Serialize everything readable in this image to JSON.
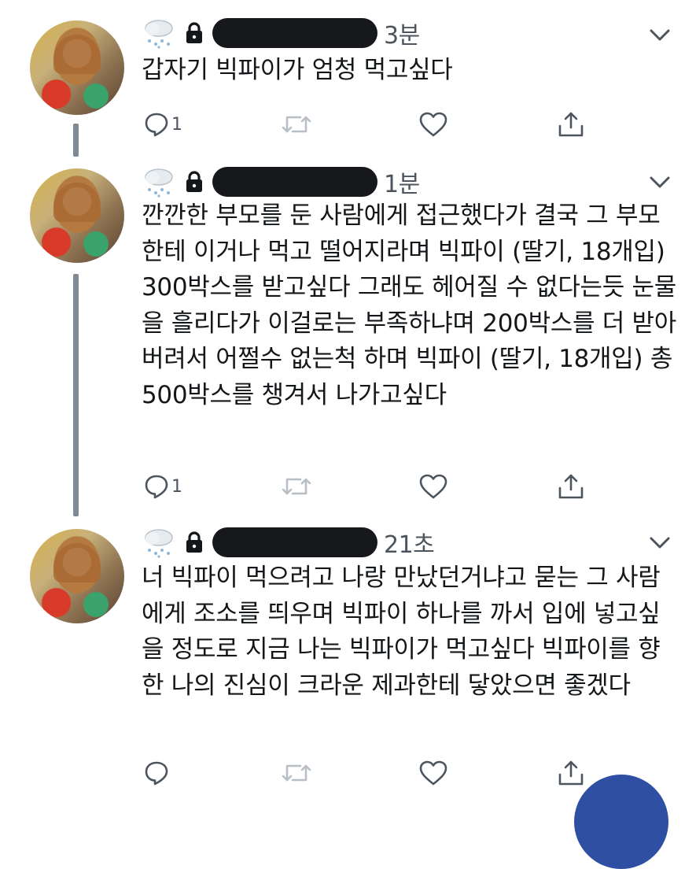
{
  "tweets": [
    {
      "time": "3분",
      "text": "갑자기 빅파이가 엄청 먹고싶다",
      "reply_count": "1"
    },
    {
      "time": "1분",
      "text": "깐깐한 부모를 둔 사람에게 접근했다가 결국 그 부모한테 이거나 먹고 떨어지라며 빅파이 (딸기, 18개입) 300박스를 받고싶다 그래도 헤어질 수 없다는듯 눈물을 흘리다가 이걸로는 부족하냐며 200박스를 더 받아버려서 어쩔수 없는척 하며 빅파이 (딸기, 18개입) 총 500박스를 챙겨서 나가고싶다",
      "reply_count": "1"
    },
    {
      "time": "21초",
      "text": "너 빅파이 먹으려고 나랑 만났던거냐고 묻는 그 사람에게 조소를 띄우며 빅파이 하나를 까서 입에 넣고싶을 정도로 지금 나는 빅파이가 먹고싶다 빅파이를 향한 나의 진심이 크라운 제과한테 닿았으면 좋겠다",
      "reply_count": ""
    }
  ],
  "colors": {
    "text": "#14171a",
    "muted": "#4c555d",
    "thread_line": "#7f8a94",
    "fab": "#2f4fa3"
  }
}
